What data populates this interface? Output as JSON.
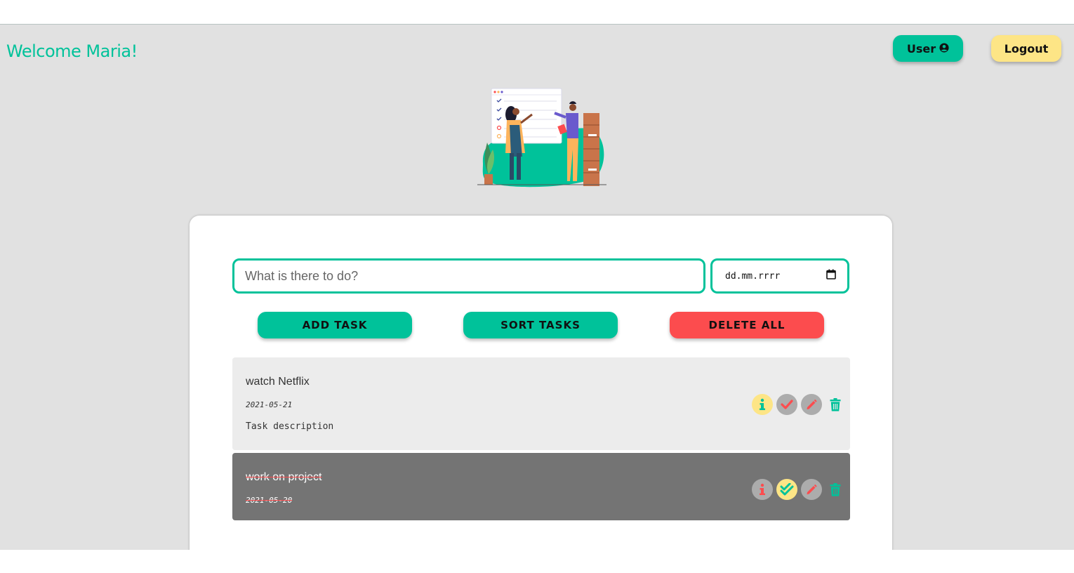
{
  "header": {
    "welcome": "Welcome Maria!",
    "user_label": "User",
    "logout_label": "Logout"
  },
  "form": {
    "task_placeholder": "What is there to do?",
    "date_placeholder": "dd.mm.rrrr"
  },
  "actions": {
    "add_label": "ADD TASK",
    "sort_label": "SORT TASKS",
    "delete_all_label": "DELETE ALL"
  },
  "tasks": [
    {
      "title": "watch Netflix",
      "date": "2021-05-21",
      "description": "Task description",
      "completed": false
    },
    {
      "title": "work on project",
      "date": "2021-05-20",
      "completed": true
    }
  ],
  "icons": {
    "user": "user-circle-icon",
    "calendar": "calendar-icon",
    "info": "info-icon",
    "check": "check-icon",
    "double_check": "double-check-icon",
    "edit": "pencil-icon",
    "trash": "trash-icon"
  },
  "colors": {
    "accent": "#00c29a",
    "danger": "#fc4c4e",
    "highlight": "#fde586",
    "background": "#e1e1e1",
    "completed_task": "#747474"
  }
}
